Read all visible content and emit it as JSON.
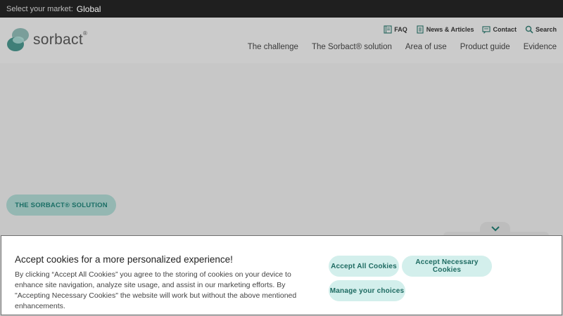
{
  "market": {
    "label": "Select your market:",
    "value": "Global"
  },
  "logo": {
    "name": "sorbact",
    "mark": "®"
  },
  "utility": [
    {
      "label": "FAQ",
      "icon": "faq-icon"
    },
    {
      "label": "News & Articles",
      "icon": "news-icon"
    },
    {
      "label": "Contact",
      "icon": "contact-icon"
    },
    {
      "label": "Search",
      "icon": "search-icon"
    }
  ],
  "nav": {
    "challenge": "The challenge",
    "solution": "The Sorbact® solution",
    "area": "Area of use",
    "guide": "Product guide",
    "evidence": "Evidence"
  },
  "hero": {
    "pill_label": "THE SORBACT® SOLUTION"
  },
  "cookie": {
    "title": "Accept cookies for a more personalized experience!",
    "body": "By clicking “Accept All Cookies” you agree to the storing of cookies on your device to enhance site navigation, analyze site usage, and assist in our marketing efforts. By \"Accepting Necessary Cookies\" the website will work but without the above mentioned enhancements.",
    "accept_all": "Accept All Cookies",
    "accept_necessary": "Accept Necessary Cookies",
    "manage": "Manage your choices"
  },
  "colors": {
    "accent": "#1d6a61",
    "button_bg": "#d3efec",
    "topbar": "#1f1f1f"
  }
}
